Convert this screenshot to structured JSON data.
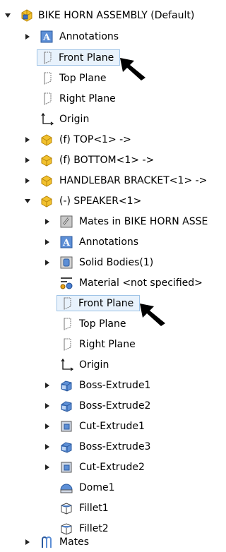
{
  "tree": {
    "root": {
      "label": "BIKE HORN ASSEMBLY  (Default)",
      "icon": "assembly-icon"
    },
    "items": [
      {
        "label": "Annotations",
        "icon": "annotations-icon"
      },
      {
        "label": "Front Plane",
        "icon": "plane-icon"
      },
      {
        "label": "Top Plane",
        "icon": "plane-icon"
      },
      {
        "label": "Right Plane",
        "icon": "plane-icon"
      },
      {
        "label": "Origin",
        "icon": "origin-icon"
      },
      {
        "label": "(f) TOP<1> ->",
        "icon": "part-icon"
      },
      {
        "label": "(f) BOTTOM<1> ->",
        "icon": "part-icon"
      },
      {
        "label": "HANDLEBAR BRACKET<1> ->",
        "icon": "part-icon"
      },
      {
        "label": "(-) SPEAKER<1>",
        "icon": "part-icon"
      }
    ],
    "speaker_children": [
      {
        "label": "Mates in BIKE HORN ASSE",
        "icon": "mates-folder-icon"
      },
      {
        "label": "Annotations",
        "icon": "annotations-icon"
      },
      {
        "label": "Solid Bodies(1)",
        "icon": "solid-bodies-icon"
      },
      {
        "label": "Material <not specified>",
        "icon": "material-icon"
      },
      {
        "label": "Front Plane",
        "icon": "plane-icon"
      },
      {
        "label": "Top Plane",
        "icon": "plane-icon"
      },
      {
        "label": "Right Plane",
        "icon": "plane-icon"
      },
      {
        "label": "Origin",
        "icon": "origin-icon"
      },
      {
        "label": "Boss-Extrude1",
        "icon": "boss-extrude-icon"
      },
      {
        "label": "Boss-Extrude2",
        "icon": "boss-extrude-icon"
      },
      {
        "label": "Cut-Extrude1",
        "icon": "cut-extrude-icon"
      },
      {
        "label": "Boss-Extrude3",
        "icon": "boss-extrude-icon"
      },
      {
        "label": "Cut-Extrude2",
        "icon": "cut-extrude-icon"
      },
      {
        "label": "Dome1",
        "icon": "dome-icon"
      },
      {
        "label": "Fillet1",
        "icon": "fillet-icon"
      },
      {
        "label": "Fillet2",
        "icon": "fillet-icon"
      }
    ],
    "mates": {
      "label": "Mates",
      "icon": "mates-icon"
    }
  },
  "colors": {
    "part_yellow": "#f2c12e",
    "part_outline": "#b8860b",
    "assembly_blue": "#3b6fc7",
    "selection_fill": "#e8f2fc",
    "selection_border": "#9ec3e6",
    "feature_blue": "#5d8fd6"
  }
}
